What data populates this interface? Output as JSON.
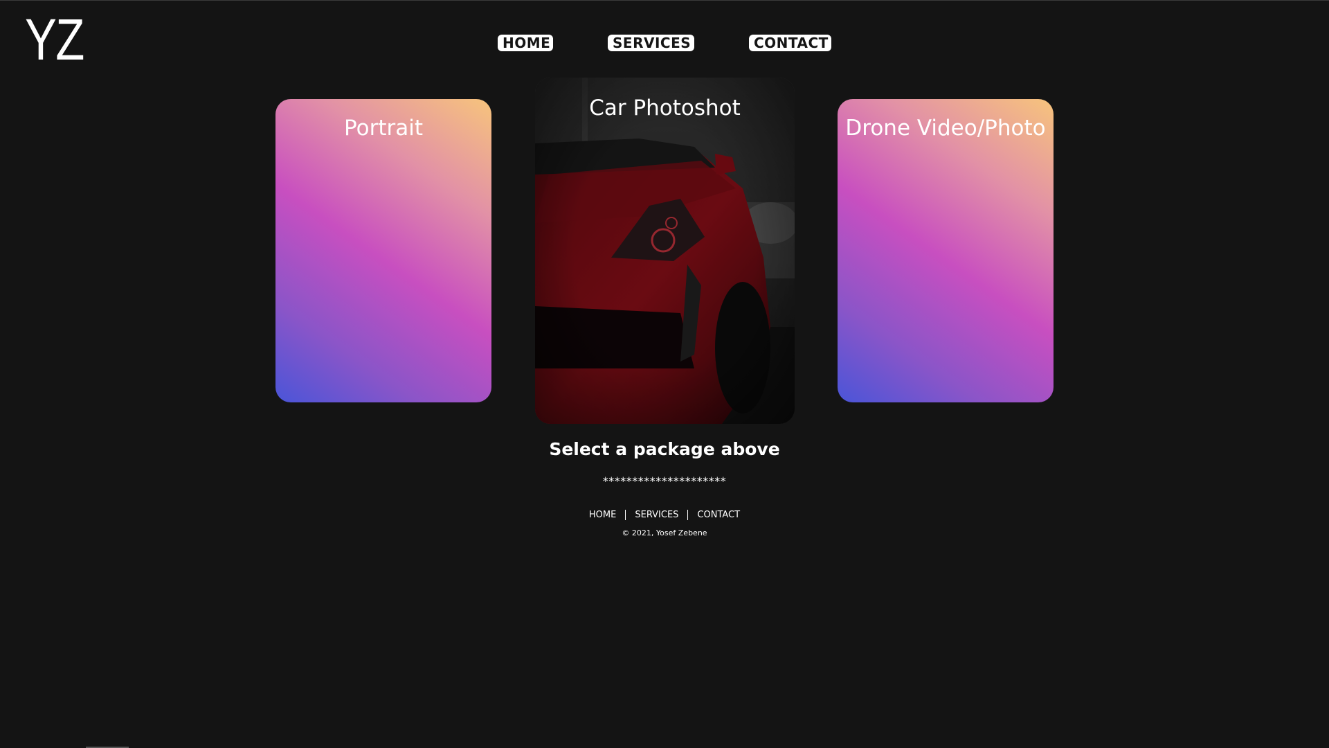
{
  "logo": {
    "text": "YZ"
  },
  "nav": {
    "home": "HOME",
    "services": "SERVICES",
    "contact": "CONTACT"
  },
  "cards": {
    "portrait": {
      "title": "Portrait"
    },
    "car": {
      "title": "Car Photoshot"
    },
    "drone": {
      "title": "Drone Video/Photo"
    }
  },
  "main": {
    "heading": "Select a package above",
    "divider": "*********************"
  },
  "footer": {
    "home": "HOME",
    "services": "SERVICES",
    "contact": "CONTACT",
    "copyright": "© 2021, Yosef Zebene"
  },
  "colors": {
    "background": "#141414",
    "gradient_start": "#4a55d8",
    "gradient_mid": "#c84fc0",
    "gradient_end": "#f7c47c",
    "car_red": "#a5121c"
  }
}
